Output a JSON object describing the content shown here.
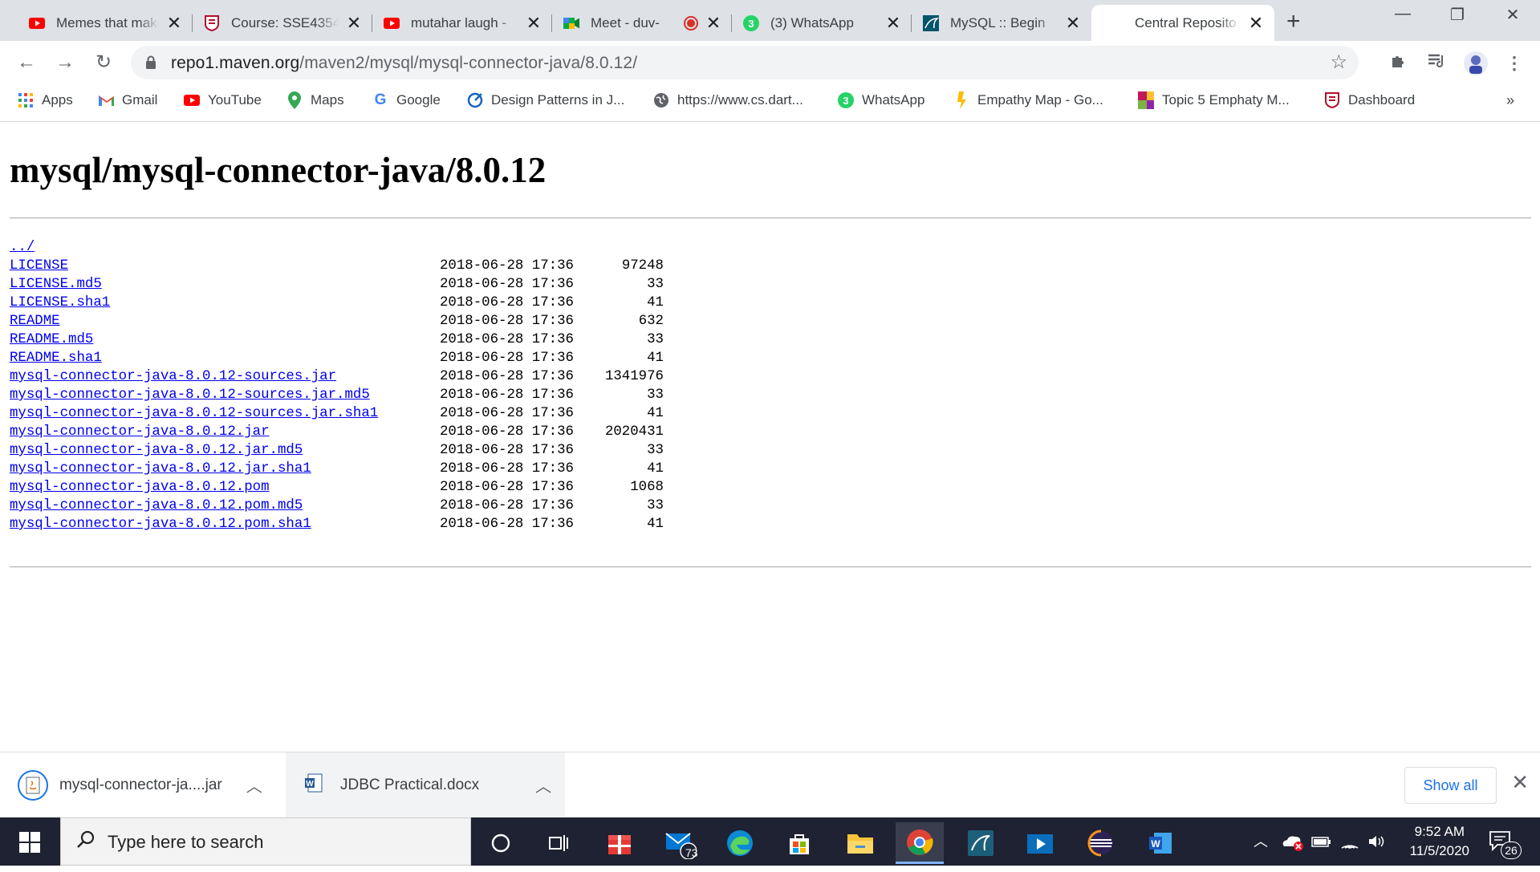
{
  "tabs": [
    {
      "title": "Memes that make",
      "icon": "youtube-icon"
    },
    {
      "title": "Course: SSE4354",
      "icon": "university-shield-icon"
    },
    {
      "title": "mutahar laugh -",
      "icon": "youtube-icon"
    },
    {
      "title": "Meet - duv-",
      "icon": "google-meet-icon"
    },
    {
      "title": "(3) WhatsApp",
      "icon": "whatsapp-icon"
    },
    {
      "title": "MySQL :: Begin",
      "icon": "mysql-icon"
    },
    {
      "title": "Central Reposito",
      "icon": "blank-page-icon",
      "active": true
    }
  ],
  "address_bar": {
    "host": "repo1.maven.org",
    "path": "/maven2/mysql/mysql-connector-java/8.0.12/"
  },
  "bookmarks": [
    {
      "label": "Apps",
      "icon": "apps-grid-icon"
    },
    {
      "label": "Gmail",
      "icon": "gmail-icon"
    },
    {
      "label": "YouTube",
      "icon": "youtube-icon"
    },
    {
      "label": "Maps",
      "icon": "maps-pin-icon"
    },
    {
      "label": "Google",
      "icon": "google-icon"
    },
    {
      "label": "Design Patterns in J...",
      "icon": "design-patterns-icon"
    },
    {
      "label": "https://www.cs.dart...",
      "icon": "globe-icon"
    },
    {
      "label": "WhatsApp",
      "icon": "whatsapp-icon"
    },
    {
      "label": "Empathy Map - Go...",
      "icon": "empathy-map-icon"
    },
    {
      "label": "Topic 5 Emphaty M...",
      "icon": "topic-icon"
    },
    {
      "label": "Dashboard",
      "icon": "university-shield-icon"
    }
  ],
  "page": {
    "heading": "mysql/mysql-connector-java/8.0.12",
    "parent_link": "../",
    "files": [
      {
        "name": "LICENSE",
        "date": "2018-06-28 17:36",
        "size": "97248"
      },
      {
        "name": "LICENSE.md5",
        "date": "2018-06-28 17:36",
        "size": "33"
      },
      {
        "name": "LICENSE.sha1",
        "date": "2018-06-28 17:36",
        "size": "41"
      },
      {
        "name": "README",
        "date": "2018-06-28 17:36",
        "size": "632"
      },
      {
        "name": "README.md5",
        "date": "2018-06-28 17:36",
        "size": "33"
      },
      {
        "name": "README.sha1",
        "date": "2018-06-28 17:36",
        "size": "41"
      },
      {
        "name": "mysql-connector-java-8.0.12-sources.jar",
        "date": "2018-06-28 17:36",
        "size": "1341976"
      },
      {
        "name": "mysql-connector-java-8.0.12-sources.jar.md5",
        "date": "2018-06-28 17:36",
        "size": "33"
      },
      {
        "name": "mysql-connector-java-8.0.12-sources.jar.sha1",
        "date": "2018-06-28 17:36",
        "size": "41"
      },
      {
        "name": "mysql-connector-java-8.0.12.jar",
        "date": "2018-06-28 17:36",
        "size": "2020431"
      },
      {
        "name": "mysql-connector-java-8.0.12.jar.md5",
        "date": "2018-06-28 17:36",
        "size": "33"
      },
      {
        "name": "mysql-connector-java-8.0.12.jar.sha1",
        "date": "2018-06-28 17:36",
        "size": "41"
      },
      {
        "name": "mysql-connector-java-8.0.12.pom",
        "date": "2018-06-28 17:36",
        "size": "1068"
      },
      {
        "name": "mysql-connector-java-8.0.12.pom.md5",
        "date": "2018-06-28 17:36",
        "size": "33"
      },
      {
        "name": "mysql-connector-java-8.0.12.pom.sha1",
        "date": "2018-06-28 17:36",
        "size": "41"
      }
    ]
  },
  "downloads": {
    "items": [
      {
        "name": "mysql-connector-ja....jar",
        "icon": "java-file-icon"
      },
      {
        "name": "JDBC Practical.docx",
        "icon": "word-file-icon"
      }
    ],
    "show_all": "Show all"
  },
  "taskbar": {
    "search_placeholder": "Type here to search",
    "mail_badge": "73",
    "time": "9:52 AM",
    "date": "11/5/2020",
    "notification_count": "26"
  },
  "colors": {
    "link": "#0000ee",
    "tab_strip": "#dee1e6",
    "taskbar": "#1f2232",
    "accent_blue": "#1a73e8"
  }
}
